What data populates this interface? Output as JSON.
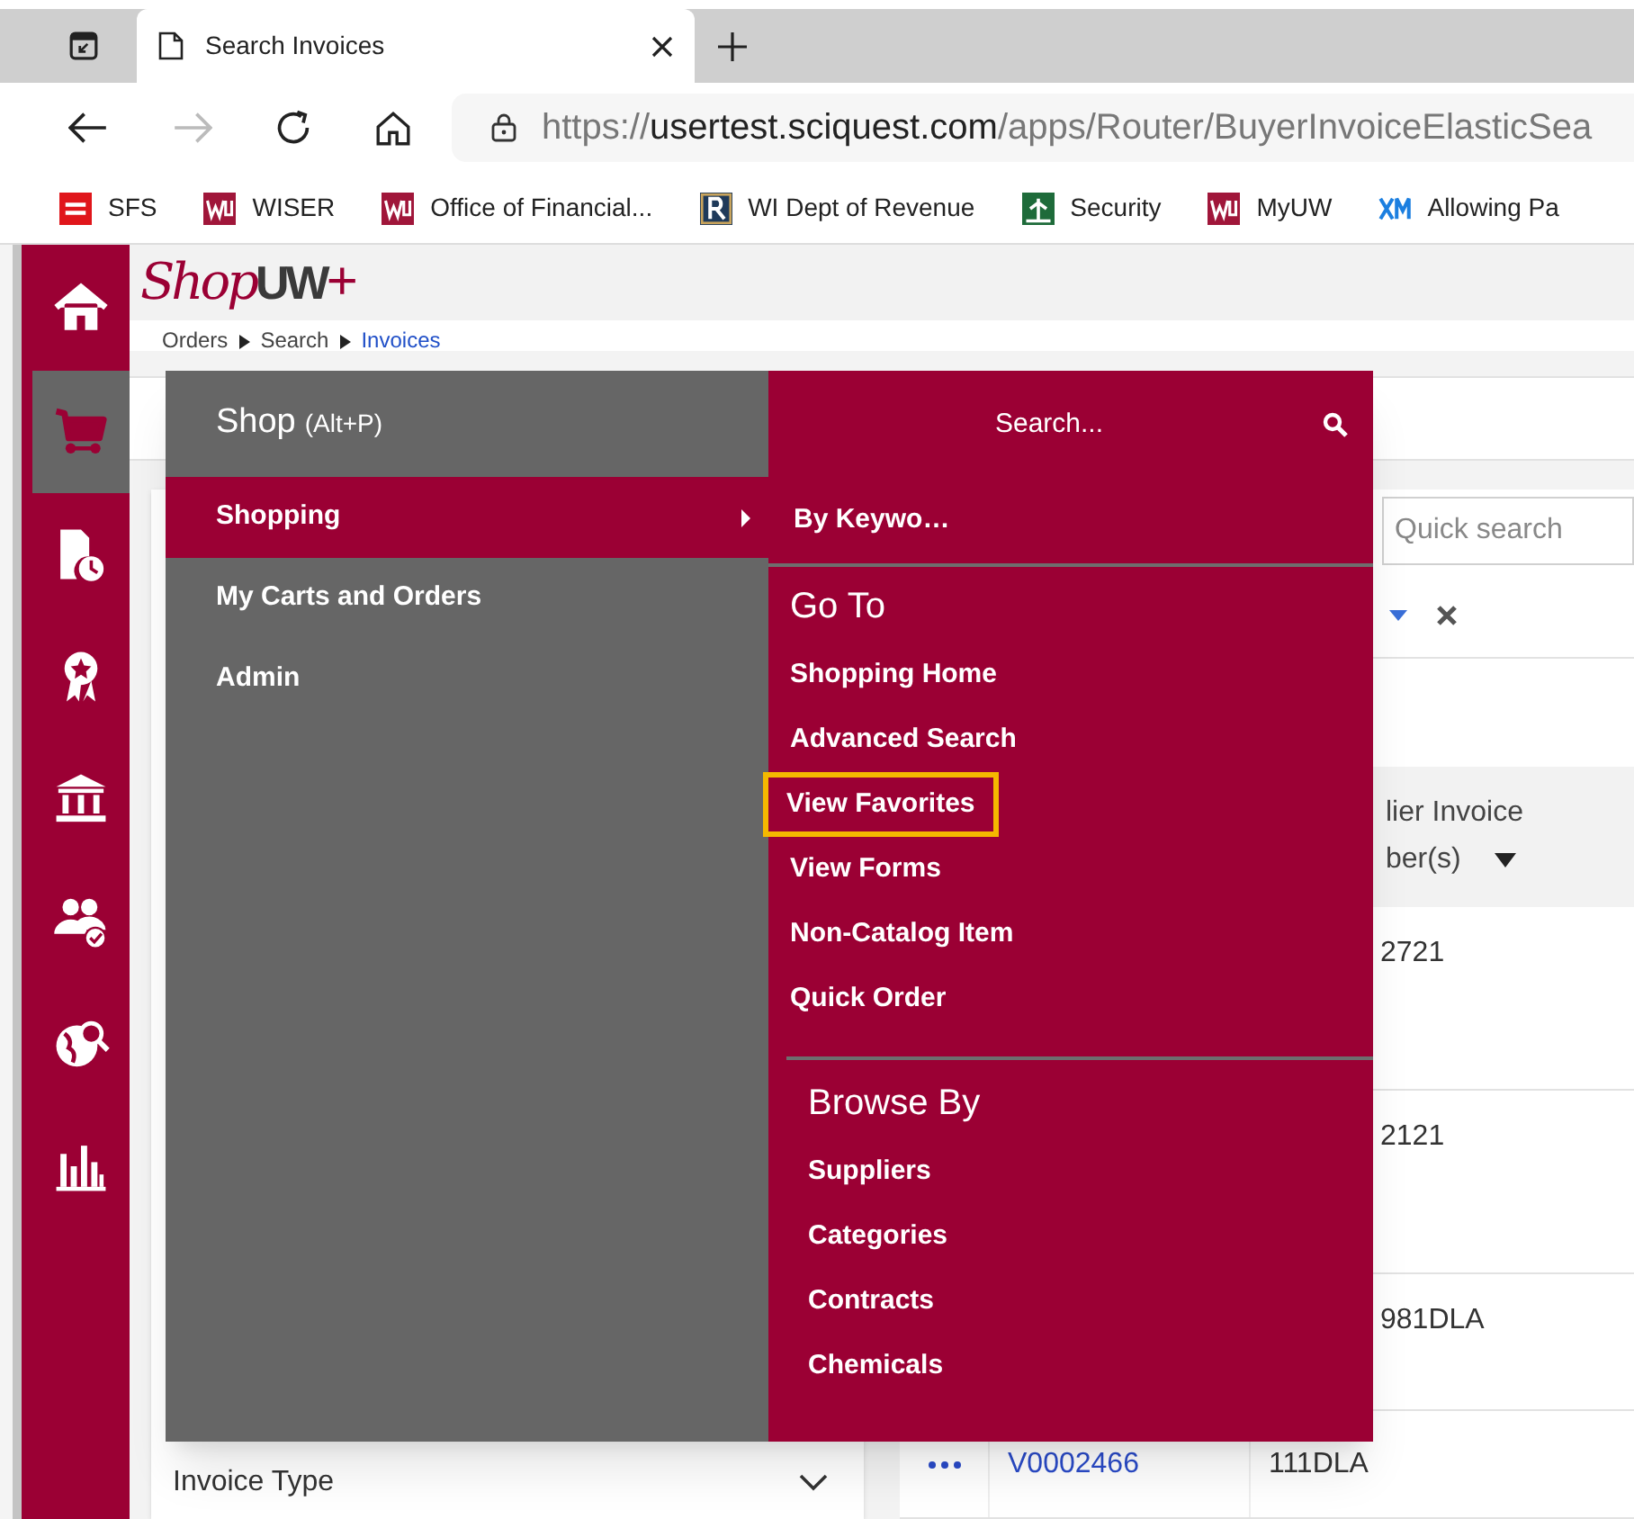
{
  "browser": {
    "tabs": [
      {
        "kind": "workspaces",
        "selected": false
      },
      {
        "kind": "page",
        "title": "Search Invoices",
        "selected": true
      }
    ],
    "url": {
      "scheme": "https://",
      "host": "usertest.sciquest.com",
      "path": "/apps/Router/BuyerInvoiceElasticSea"
    },
    "bookmarks": [
      {
        "label": "SFS"
      },
      {
        "label": "WISER"
      },
      {
        "label": "Office of Financial..."
      },
      {
        "label": "WI Dept of Revenue"
      },
      {
        "label": "Security"
      },
      {
        "label": "MyUW"
      },
      {
        "label": "Allowing Pa"
      }
    ]
  },
  "rail": [
    {
      "selected": false
    },
    {
      "selected": true
    },
    {
      "selected": false
    },
    {
      "selected": false
    },
    {
      "selected": false
    },
    {
      "selected": false
    },
    {
      "selected": false
    },
    {
      "selected": false
    }
  ],
  "logo": {
    "script": "Shop",
    "mark": "UW",
    "plus": "+"
  },
  "breadcrumb": [
    {
      "label": "Orders",
      "current": false
    },
    {
      "label": "Search",
      "current": false
    },
    {
      "label": "Invoices",
      "current": true
    }
  ],
  "menu": {
    "title": "Shop",
    "shortcut": "(Alt+P)",
    "items": [
      {
        "label": "Shopping",
        "selected": true,
        "submenu": true
      },
      {
        "label": "My Carts and Orders",
        "selected": false,
        "submenu": false
      },
      {
        "label": "Admin",
        "selected": false,
        "submenu": false
      }
    ],
    "search": {
      "placeholder": "Search..."
    },
    "quick_link": "By Keywo…",
    "sections": [
      {
        "heading": "Go To",
        "items": [
          {
            "label": "Shopping Home",
            "highlighted": false
          },
          {
            "label": "Advanced Search",
            "highlighted": false
          },
          {
            "label": "View Favorites",
            "highlighted": true
          },
          {
            "label": "View Forms",
            "highlighted": false
          },
          {
            "label": "Non-Catalog Item",
            "highlighted": false
          },
          {
            "label": "Quick Order",
            "highlighted": false
          }
        ]
      },
      {
        "heading": "Browse By",
        "items": [
          {
            "label": "Suppliers",
            "highlighted": false
          },
          {
            "label": "Categories",
            "highlighted": false
          },
          {
            "label": "Contracts",
            "highlighted": false
          },
          {
            "label": "Chemicals",
            "highlighted": false
          }
        ]
      }
    ]
  },
  "filters": {
    "field": "Invoice Type"
  },
  "results": {
    "quick_search": {
      "placeholder": "Quick search"
    },
    "header": [
      "lier Invoice",
      "ber(s)"
    ],
    "rows": [
      {
        "column_3": "2721"
      },
      {
        "column_3": "2121"
      },
      {
        "column_3": "981DLA"
      },
      {
        "column_2": "V0002466",
        "column_3": "111DLA"
      }
    ]
  }
}
